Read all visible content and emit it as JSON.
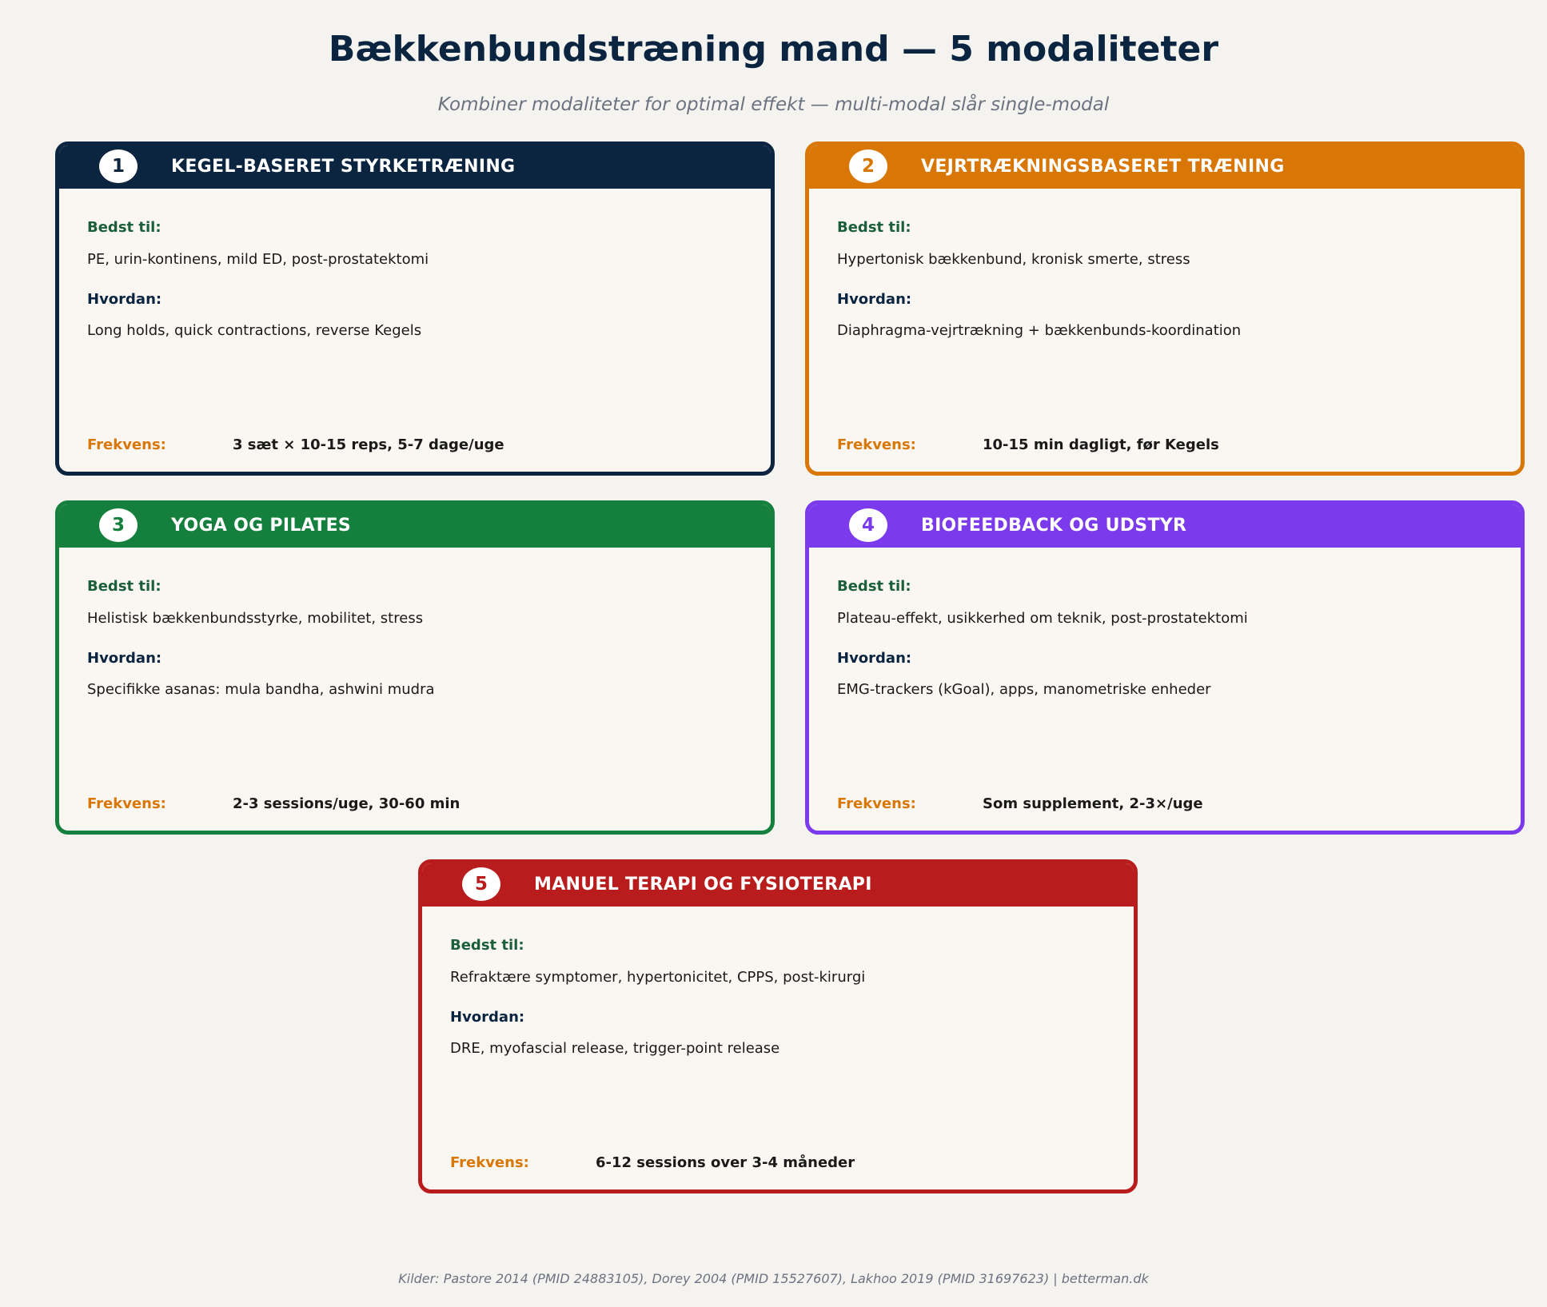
{
  "title": "Bækkenbundstræning mand — 5 modaliteter",
  "subtitle": "Kombiner modaliteter for optimal effekt — multi-modal slår single-modal",
  "labels": {
    "best": "Bedst til:",
    "how": "Hvordan:",
    "freq": "Frekvens:"
  },
  "colors": {
    "background": "#f5f3f0",
    "best_label": "#1b5e3a",
    "how_label": "#0b2540",
    "freq_label": "#d97706"
  },
  "modalities": [
    {
      "number": "1",
      "title": "KEGEL-BASERET STYRKETRÆNING",
      "color": "#0b2540",
      "best": "PE, urin-kontinens, mild ED, post-prostatektomi",
      "how": "Long holds, quick contractions, reverse Kegels",
      "freq": "3 sæt × 10-15 reps, 5-7 dage/uge"
    },
    {
      "number": "2",
      "title": "VEJRTRÆKNINGSBASERET TRÆNING",
      "color": "#d97706",
      "best": "Hypertonisk bækkenbund, kronisk smerte, stress",
      "how": "Diaphragma-vejrtrækning + bækkenbunds-koordination",
      "freq": "10-15 min dagligt, før Kegels"
    },
    {
      "number": "3",
      "title": "YOGA OG PILATES",
      "color": "#15803d",
      "best": "Helistisk bækkenbundsstyrke, mobilitet, stress",
      "how": "Specifikke asanas: mula bandha, ashwini mudra",
      "freq": "2-3 sessions/uge, 30-60 min"
    },
    {
      "number": "4",
      "title": "BIOFEEDBACK OG UDSTYR",
      "color": "#7c3aed",
      "best": "Plateau-effekt, usikkerhed om teknik, post-prostatektomi",
      "how": "EMG-trackers (kGoal), apps, manometriske enheder",
      "freq": "Som supplement, 2-3×/uge"
    },
    {
      "number": "5",
      "title": "MANUEL TERAPI OG FYSIOTERAPI",
      "color": "#b91c1c",
      "best": "Refraktære symptomer, hypertonicitet, CPPS, post-kirurgi",
      "how": "DRE, myofascial release, trigger-point release",
      "freq": "6-12 sessions over 3-4 måneder"
    }
  ],
  "footer": "Kilder: Pastore 2014 (PMID 24883105), Dorey 2004 (PMID 15527607), Lakhoo 2019 (PMID 31697623) | betterman.dk"
}
